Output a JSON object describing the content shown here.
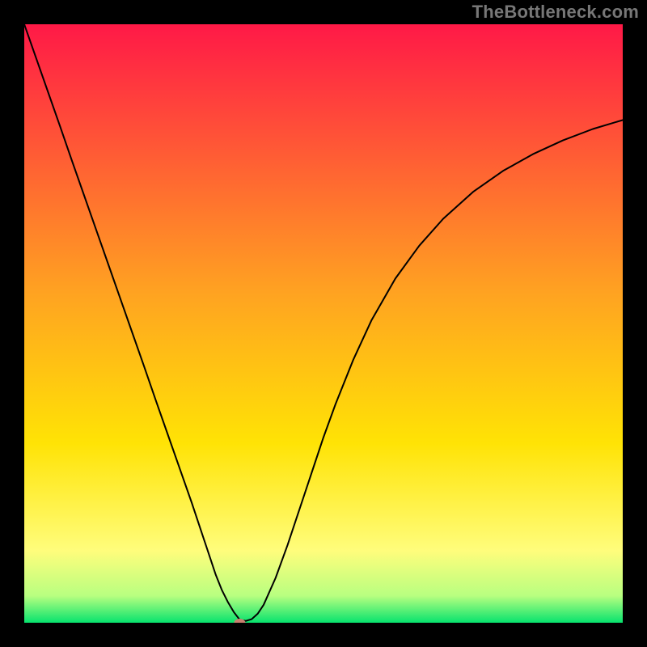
{
  "watermark": "TheBottleneck.com",
  "chart_data": {
    "type": "line",
    "title": "",
    "xlabel": "",
    "ylabel": "",
    "xlim": [
      0,
      100
    ],
    "ylim": [
      0,
      100
    ],
    "x_ticks": [],
    "y_ticks": [],
    "grid": false,
    "background_gradient": [
      {
        "stop": 0.0,
        "color": "#ff1947"
      },
      {
        "stop": 0.45,
        "color": "#ffa321"
      },
      {
        "stop": 0.7,
        "color": "#ffe305"
      },
      {
        "stop": 0.88,
        "color": "#fffd7c"
      },
      {
        "stop": 0.955,
        "color": "#b8ff80"
      },
      {
        "stop": 1.0,
        "color": "#07e36e"
      }
    ],
    "marker": {
      "x": 36,
      "y": 0,
      "color": "#c97f6f",
      "rx": 7,
      "ry": 5
    },
    "series": [
      {
        "name": "bottleneck-curve",
        "color": "#000000",
        "width": 2,
        "x": [
          0,
          2,
          4,
          6,
          8,
          10,
          12,
          14,
          16,
          18,
          20,
          22,
          24,
          26,
          28,
          30,
          31,
          32,
          33,
          34,
          35,
          36,
          37,
          38,
          39,
          40,
          42,
          44,
          46,
          48,
          50,
          52,
          55,
          58,
          62,
          66,
          70,
          75,
          80,
          85,
          90,
          95,
          100
        ],
        "y": [
          100,
          94.3,
          88.6,
          82.9,
          77.1,
          71.4,
          65.7,
          60.0,
          54.3,
          48.6,
          42.9,
          37.1,
          31.4,
          25.7,
          20.0,
          14.0,
          11.0,
          8.0,
          5.5,
          3.5,
          1.8,
          0.5,
          0.3,
          0.6,
          1.5,
          3.0,
          7.5,
          13.0,
          19.0,
          25.0,
          31.0,
          36.5,
          44.0,
          50.5,
          57.5,
          63.0,
          67.5,
          72.0,
          75.5,
          78.3,
          80.6,
          82.5,
          84.0
        ]
      }
    ]
  }
}
